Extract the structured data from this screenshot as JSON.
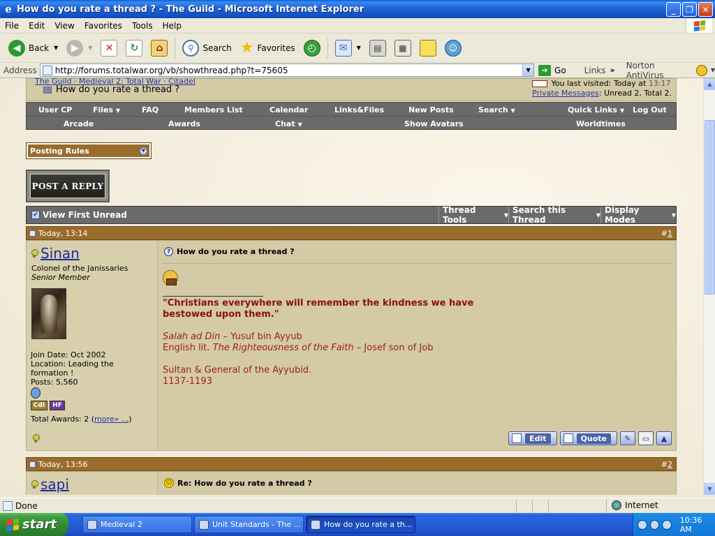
{
  "window": {
    "title": "How do you rate a thread ? - The Guild - Microsoft Internet Explorer",
    "buttons": {
      "minimize": "_",
      "maximize": "❐",
      "close": "✕"
    }
  },
  "menubar": {
    "items": [
      "File",
      "Edit",
      "View",
      "Favorites",
      "Tools",
      "Help"
    ]
  },
  "toolbar": {
    "back_label": "Back",
    "search_label": "Search",
    "favorites_label": "Favorites"
  },
  "addressbar": {
    "label": "Address",
    "url": "http://forums.totalwar.org/vb/showthread.php?t=75605",
    "go_label": "Go",
    "links_label": "Links",
    "links_chevron": "»",
    "norton_label": "Norton AntiVirus"
  },
  "forum": {
    "breadcrumb": "The Guild · Medieval 2: Total War · Citadel",
    "thread_title": "How do you rate a thread ?",
    "last_visited_text": "You last visited: Today at",
    "last_visited_time": "13:17",
    "pm_label": "Private Messages",
    "pm_status": ": Unread 2, Total 2.",
    "nav_row1": [
      {
        "label": "User CP",
        "drop": false
      },
      {
        "label": "Files",
        "drop": true
      },
      {
        "label": "FAQ",
        "drop": false
      },
      {
        "label": "Members List",
        "drop": false
      },
      {
        "label": "Calendar",
        "drop": false
      },
      {
        "label": "Links&Files",
        "drop": false
      },
      {
        "label": "New Posts",
        "drop": false
      },
      {
        "label": "Search",
        "drop": true
      },
      {
        "label": "Quick Links",
        "drop": true
      },
      {
        "label": "Log Out",
        "drop": false
      }
    ],
    "nav_row2": [
      {
        "label": "Arcade",
        "drop": false
      },
      {
        "label": "Awards",
        "drop": false
      },
      {
        "label": "Chat",
        "drop": true
      },
      {
        "label": "Show Avatars",
        "drop": false
      },
      {
        "label": "Worldtimes",
        "drop": false
      }
    ],
    "posting_rules_label": "Posting Rules",
    "post_reply_label": "POST A REPLY",
    "thread_bar": {
      "view_first_unread": "View First Unread",
      "thread_tools": "Thread Tools",
      "search_thread": "Search this Thread",
      "display_modes": "Display Modes"
    },
    "posts": [
      {
        "time": "Today, 13:14",
        "number_prefix": "#",
        "number": "1",
        "username": "Sinan",
        "user_title": "Colonel of the Janissaries",
        "user_rank": "Senior Member",
        "join_date": "Join Date: Oct 2002",
        "location": "Location: Leading the formation !",
        "posts": "Posts: 5,560",
        "total_awards": "Total Awards: 2 (",
        "more_link": "more» ...",
        "awards_close": ")",
        "badge1": "CdI",
        "badge2": "HF",
        "title": "How do you rate a thread ?",
        "quote": "\"Christians everywhere will remember the kindness we have bestowed upon them.\"",
        "sig_line1_italic": "Salah ad Din",
        "sig_line1_rest": " – Yusuf bin Ayyub",
        "sig_line2_start": "English lit. ",
        "sig_line2_italic": "The Righteousness of the Faith",
        "sig_line2_rest": " – Josef son of Job",
        "sig_line3": "Sultan & General of the Ayyubid.",
        "sig_line4": "1137-1193",
        "edit_label": "Edit",
        "quote_label": "Quote"
      },
      {
        "time": "Today, 13:56",
        "number_prefix": "#",
        "number": "2",
        "username": "sapi",
        "title": "Re: How do you rate a thread ?"
      }
    ]
  },
  "statusbar": {
    "status": "Done",
    "zone": "Internet"
  },
  "taskbar": {
    "start_label": "start",
    "tasks": [
      "Medieval 2",
      "Unit Standards - The ...",
      "How do you rate a th..."
    ],
    "active_task": 2,
    "clock": "10:36 AM"
  },
  "colors": {
    "post_header": "#9a6c2c",
    "post_body": "#d4caa6",
    "navbar": "#6a6a6a",
    "username_link": "#1f2a9e",
    "signature_red": "#8b1010"
  }
}
